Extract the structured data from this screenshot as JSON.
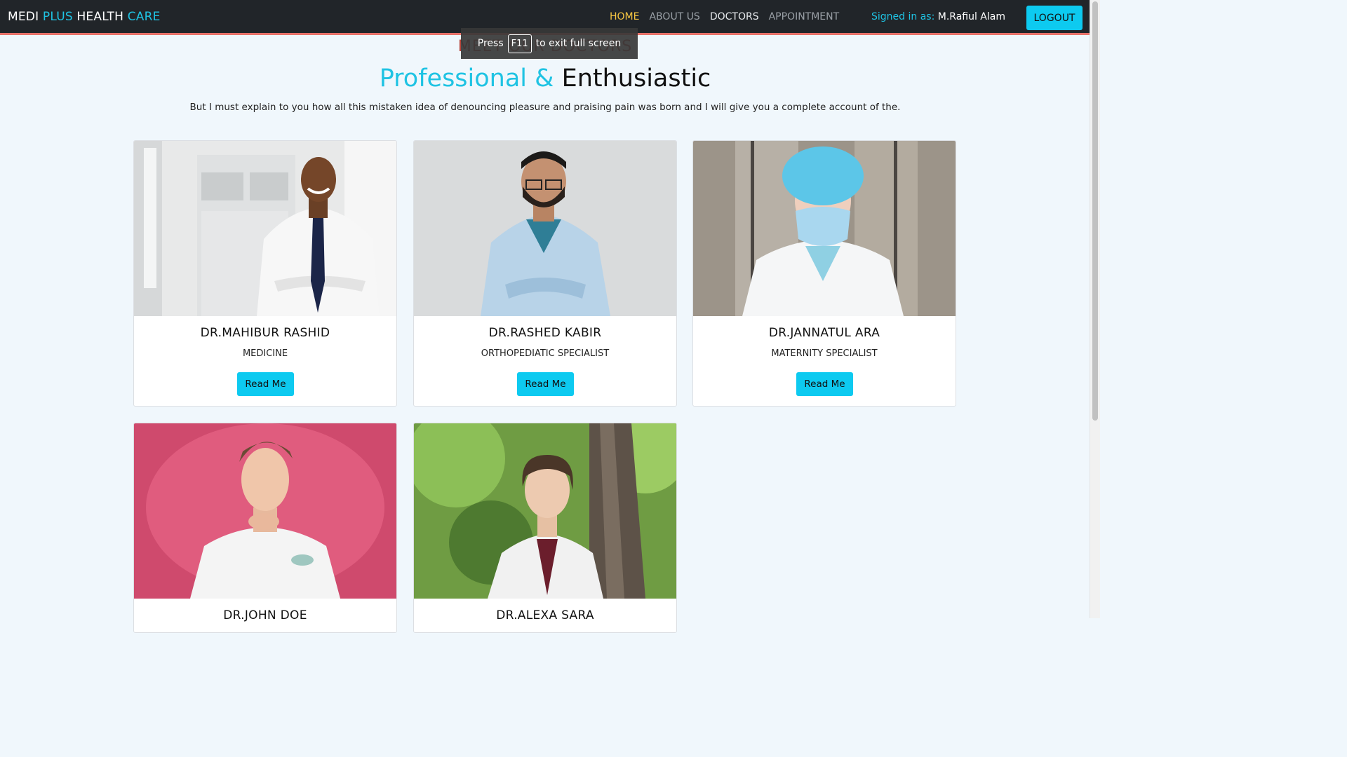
{
  "navbar": {
    "brand": {
      "part1": "MEDI ",
      "part2": "PLUS",
      "part3": " HEALTH ",
      "part4": "CARE"
    },
    "links": [
      {
        "label": "HOME"
      },
      {
        "label": "ABOUT US"
      },
      {
        "label": "DOCTORS"
      },
      {
        "label": "APPOINTMENT"
      }
    ],
    "signed_label": "Signed in as: ",
    "signed_user": "M.Rafiul Alam",
    "logout_label": "LOGOUT"
  },
  "fullscreen_toast": {
    "before": "Press",
    "key": "F11",
    "after": "to exit full screen"
  },
  "section": {
    "kicker": "MEET OUR DOCTORS",
    "headline_accent": "Professional & ",
    "headline_rest": "Enthusiastic",
    "lead": "But I must explain to you how all this mistaken idea of denouncing pleasure and praising pain was born and I will give you a complete account of the."
  },
  "doctors": [
    {
      "name": "DR.MAHIBUR RASHID",
      "specialty": "MEDICINE",
      "button": "Read Me"
    },
    {
      "name": "DR.RASHED KABIR",
      "specialty": "ORTHOPEDIATIC SPECIALIST",
      "button": "Read Me"
    },
    {
      "name": "DR.JANNATUL ARA",
      "specialty": "MATERNITY SPECIALIST",
      "button": "Read Me"
    },
    {
      "name": "DR.JOHN DOE",
      "specialty": "",
      "button": ""
    },
    {
      "name": "DR.ALEXA SARA",
      "specialty": "",
      "button": ""
    }
  ],
  "colors": {
    "accent": "#1fc3e3",
    "button": "#0dcaf0",
    "nav_bg": "#212529",
    "active_link": "#f5c542"
  }
}
